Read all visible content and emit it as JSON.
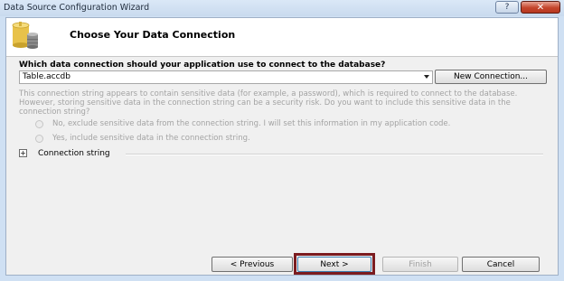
{
  "window": {
    "title": "Data Source Configuration Wizard",
    "help_label": "?",
    "close_label": "✕"
  },
  "header": {
    "title": "Choose Your Data Connection",
    "icon": "database-icon"
  },
  "connection": {
    "question": "Which data connection should your application use to connect to the database?",
    "selected": "Table.accdb",
    "new_connection_label": "New Connection..."
  },
  "sensitive": {
    "notice": "This connection string appears to contain sensitive data (for example, a password), which is required to connect to the database. However, storing sensitive data in the connection string can be a security risk. Do you want to include this sensitive data in the connection string?",
    "option_exclude": "No, exclude sensitive data from the connection string. I will set this information in my application code.",
    "option_include": "Yes, include sensitive data in the connection string."
  },
  "connection_string": {
    "expander": "+",
    "label": "Connection string"
  },
  "buttons": {
    "previous": "< Previous",
    "next": "Next >",
    "finish": "Finish",
    "cancel": "Cancel"
  },
  "colors": {
    "next_highlight": "#7b1c20",
    "disabled_text": "#a3a3a3"
  }
}
